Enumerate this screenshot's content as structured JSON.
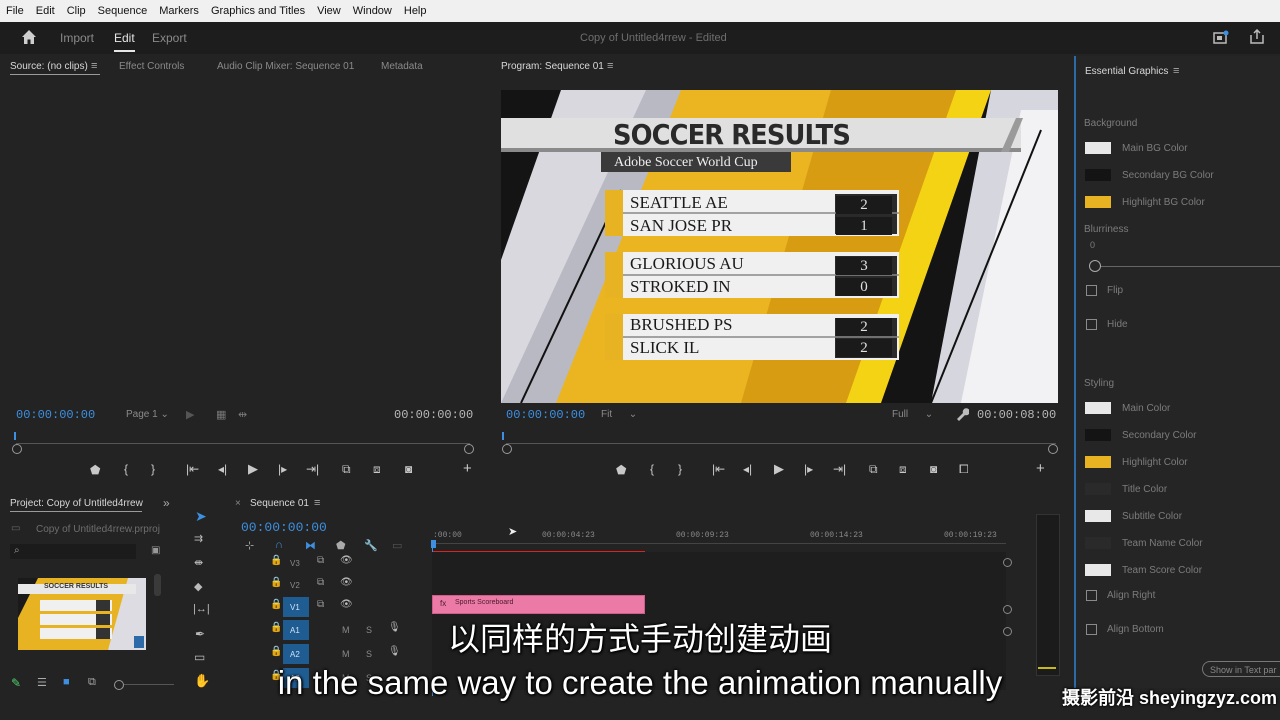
{
  "menu": [
    "File",
    "Edit",
    "Clip",
    "Sequence",
    "Markers",
    "Graphics and Titles",
    "View",
    "Window",
    "Help"
  ],
  "header": {
    "import": "Import",
    "edit": "Edit",
    "export": "Export",
    "title": "Copy of Untitled4rrew",
    "edited": "- Edited"
  },
  "source": {
    "tabs": [
      "Source: (no clips)",
      "Effect Controls",
      "Audio Clip Mixer: Sequence 01",
      "Metadata"
    ],
    "tc_left": "00:00:00:00",
    "page": "Page 1",
    "tc_right": "00:00:00:00"
  },
  "program": {
    "tab": "Program: Sequence 01",
    "tc_left": "00:00:00:00",
    "fit": "Fit",
    "full": "Full",
    "tc_right": "00:00:08:00",
    "graphic": {
      "title": "SOCCER RESULTS",
      "subtitle": "Adobe Soccer World Cup",
      "matches": [
        {
          "team1": "SEATTLE AE",
          "score1": "2",
          "team2": "SAN JOSE PR",
          "score2": "1"
        },
        {
          "team1": "GLORIOUS AU",
          "score1": "3",
          "team2": "STROKED IN",
          "score2": "0"
        },
        {
          "team1": "BRUSHED PS",
          "score1": "2",
          "team2": "SLICK IL",
          "score2": "2"
        }
      ]
    }
  },
  "essential_graphics": {
    "title": "Essential Graphics",
    "background_heading": "Background",
    "bg_items": [
      {
        "label": "Main BG Color",
        "color": "#e8e8e8"
      },
      {
        "label": "Secondary BG Color",
        "color": "#141414"
      },
      {
        "label": "Highlight BG Color",
        "color": "#e8b323"
      }
    ],
    "blurriness_label": "Blurriness",
    "blurriness_value": "0",
    "flip": "Flip",
    "hide": "Hide",
    "styling_heading": "Styling",
    "style_items": [
      {
        "label": "Main Color",
        "color": "#e8e8e8"
      },
      {
        "label": "Secondary Color",
        "color": "#141414"
      },
      {
        "label": "Highlight Color",
        "color": "#e8b323"
      },
      {
        "label": "Title Color",
        "color": "#2a2a2a"
      },
      {
        "label": "Subtitle Color",
        "color": "#e8e8e8"
      },
      {
        "label": "Team Name Color",
        "color": "#2a2a2a"
      },
      {
        "label": "Team Score Color",
        "color": "#e8e8e8"
      }
    ],
    "align_right": "Align Right",
    "align_bottom": "Align Bottom",
    "show_text": "Show in Text par"
  },
  "project": {
    "tab": "Project: Copy of Untitled4rrew",
    "file": "Copy of Untitled4rrew.prproj",
    "thumb_title": "SOCCER RESULTS"
  },
  "timeline": {
    "tab": "Sequence 01",
    "tc": "00:00:00:00",
    "ruler": [
      ":00:00",
      "00:00:04:23",
      "00:00:09:23",
      "00:00:14:23",
      "00:00:19:23"
    ],
    "tracks": [
      {
        "name": "V3"
      },
      {
        "name": "V2"
      },
      {
        "name": "V1"
      },
      {
        "name": "A1"
      },
      {
        "name": "A2"
      },
      {
        "name": "A3"
      }
    ],
    "clip_label": "Sports Scoreboard",
    "m": "M",
    "s": "S"
  },
  "subtitle_cn": "以同样的方式手动创建动画",
  "subtitle_en": "in the same way to create the animation manually",
  "watermark": "摄影前沿 sheyingzyz.com"
}
